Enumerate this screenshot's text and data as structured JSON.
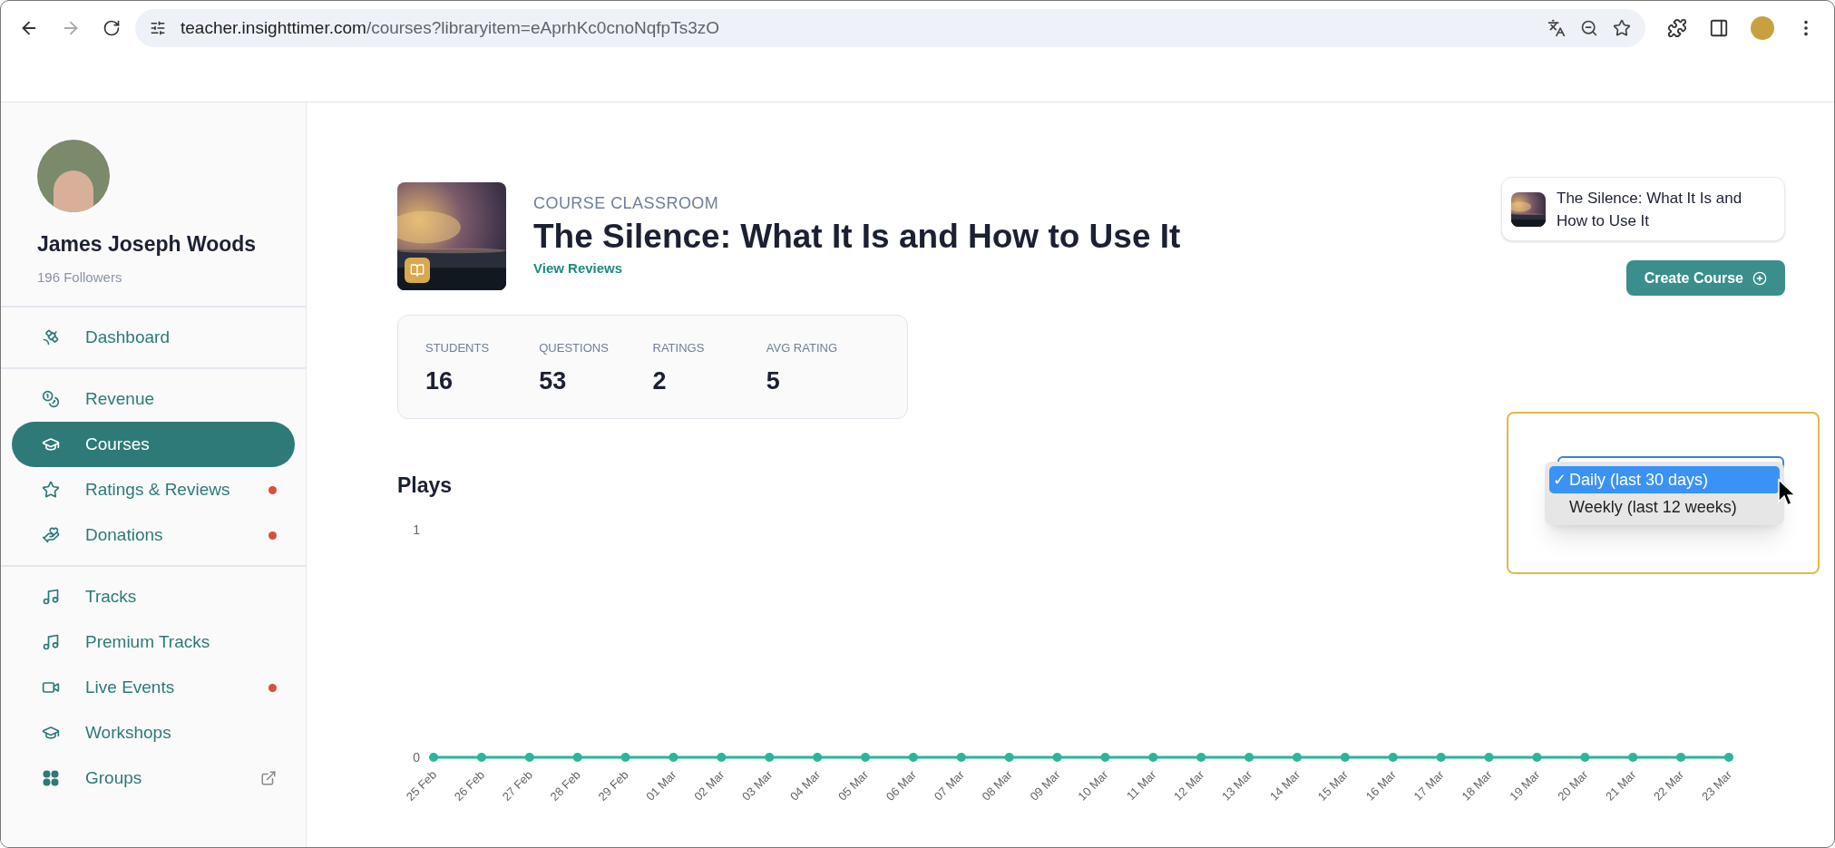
{
  "browser": {
    "url_host": "teacher.insighttimer.com",
    "url_path": "/courses?libraryitem=eAprhKc0cnoNqfpTs3zO"
  },
  "profile": {
    "name": "James Joseph Woods",
    "followers": "196 Followers"
  },
  "nav_groups": [
    [
      {
        "label": "Dashboard",
        "selected": false,
        "badge": false,
        "external": false
      }
    ],
    [
      {
        "label": "Revenue",
        "selected": false,
        "badge": false,
        "external": false
      },
      {
        "label": "Courses",
        "selected": true,
        "badge": false,
        "external": false
      },
      {
        "label": "Ratings & Reviews",
        "selected": false,
        "badge": true,
        "external": false
      },
      {
        "label": "Donations",
        "selected": false,
        "badge": true,
        "external": false
      }
    ],
    [
      {
        "label": "Tracks",
        "selected": false,
        "badge": false,
        "external": false
      },
      {
        "label": "Premium Tracks",
        "selected": false,
        "badge": false,
        "external": false
      },
      {
        "label": "Live Events",
        "selected": false,
        "badge": true,
        "external": false
      },
      {
        "label": "Workshops",
        "selected": false,
        "badge": false,
        "external": false
      },
      {
        "label": "Groups",
        "selected": false,
        "badge": false,
        "external": true
      }
    ]
  ],
  "course": {
    "eyebrow": "COURSE CLASSROOM",
    "title": "The Silence: What It Is and How to Use It",
    "link": "View Reviews"
  },
  "stats": [
    {
      "label": "STUDENTS",
      "value": "16"
    },
    {
      "label": "QUESTIONS",
      "value": "53"
    },
    {
      "label": "RATINGS",
      "value": "2"
    },
    {
      "label": "AVG RATING",
      "value": "5"
    }
  ],
  "course_card": {
    "title": "The Silence: What It Is and How to Use It"
  },
  "create_button": "Create Course",
  "plays": {
    "chart_data": {
      "type": "line",
      "title": "Plays",
      "categories": [
        "25 Feb",
        "26 Feb",
        "27 Feb",
        "28 Feb",
        "29 Feb",
        "01 Mar",
        "02 Mar",
        "03 Mar",
        "04 Mar",
        "05 Mar",
        "06 Mar",
        "07 Mar",
        "08 Mar",
        "09 Mar",
        "10 Mar",
        "11 Mar",
        "12 Mar",
        "13 Mar",
        "14 Mar",
        "15 Mar",
        "16 Mar",
        "17 Mar",
        "18 Mar",
        "19 Mar",
        "20 Mar",
        "21 Mar",
        "22 Mar",
        "23 Mar"
      ],
      "series": [
        {
          "color": "#2bb59a",
          "marker": "circle",
          "values": [
            0,
            0,
            0,
            0,
            0,
            0,
            0,
            0,
            0,
            0,
            0,
            0,
            0,
            0,
            0,
            0,
            0,
            0,
            0,
            0,
            0,
            0,
            0,
            0,
            0,
            0,
            0,
            0
          ]
        }
      ],
      "ylim": [
        0,
        1
      ],
      "yticks": [
        0,
        1
      ]
    }
  },
  "period_menu": {
    "check_mark": "✓",
    "options": [
      {
        "label": "Daily (last 30 days)",
        "selected": true
      },
      {
        "label": "Weekly (last 12 weeks)",
        "selected": false
      }
    ]
  }
}
